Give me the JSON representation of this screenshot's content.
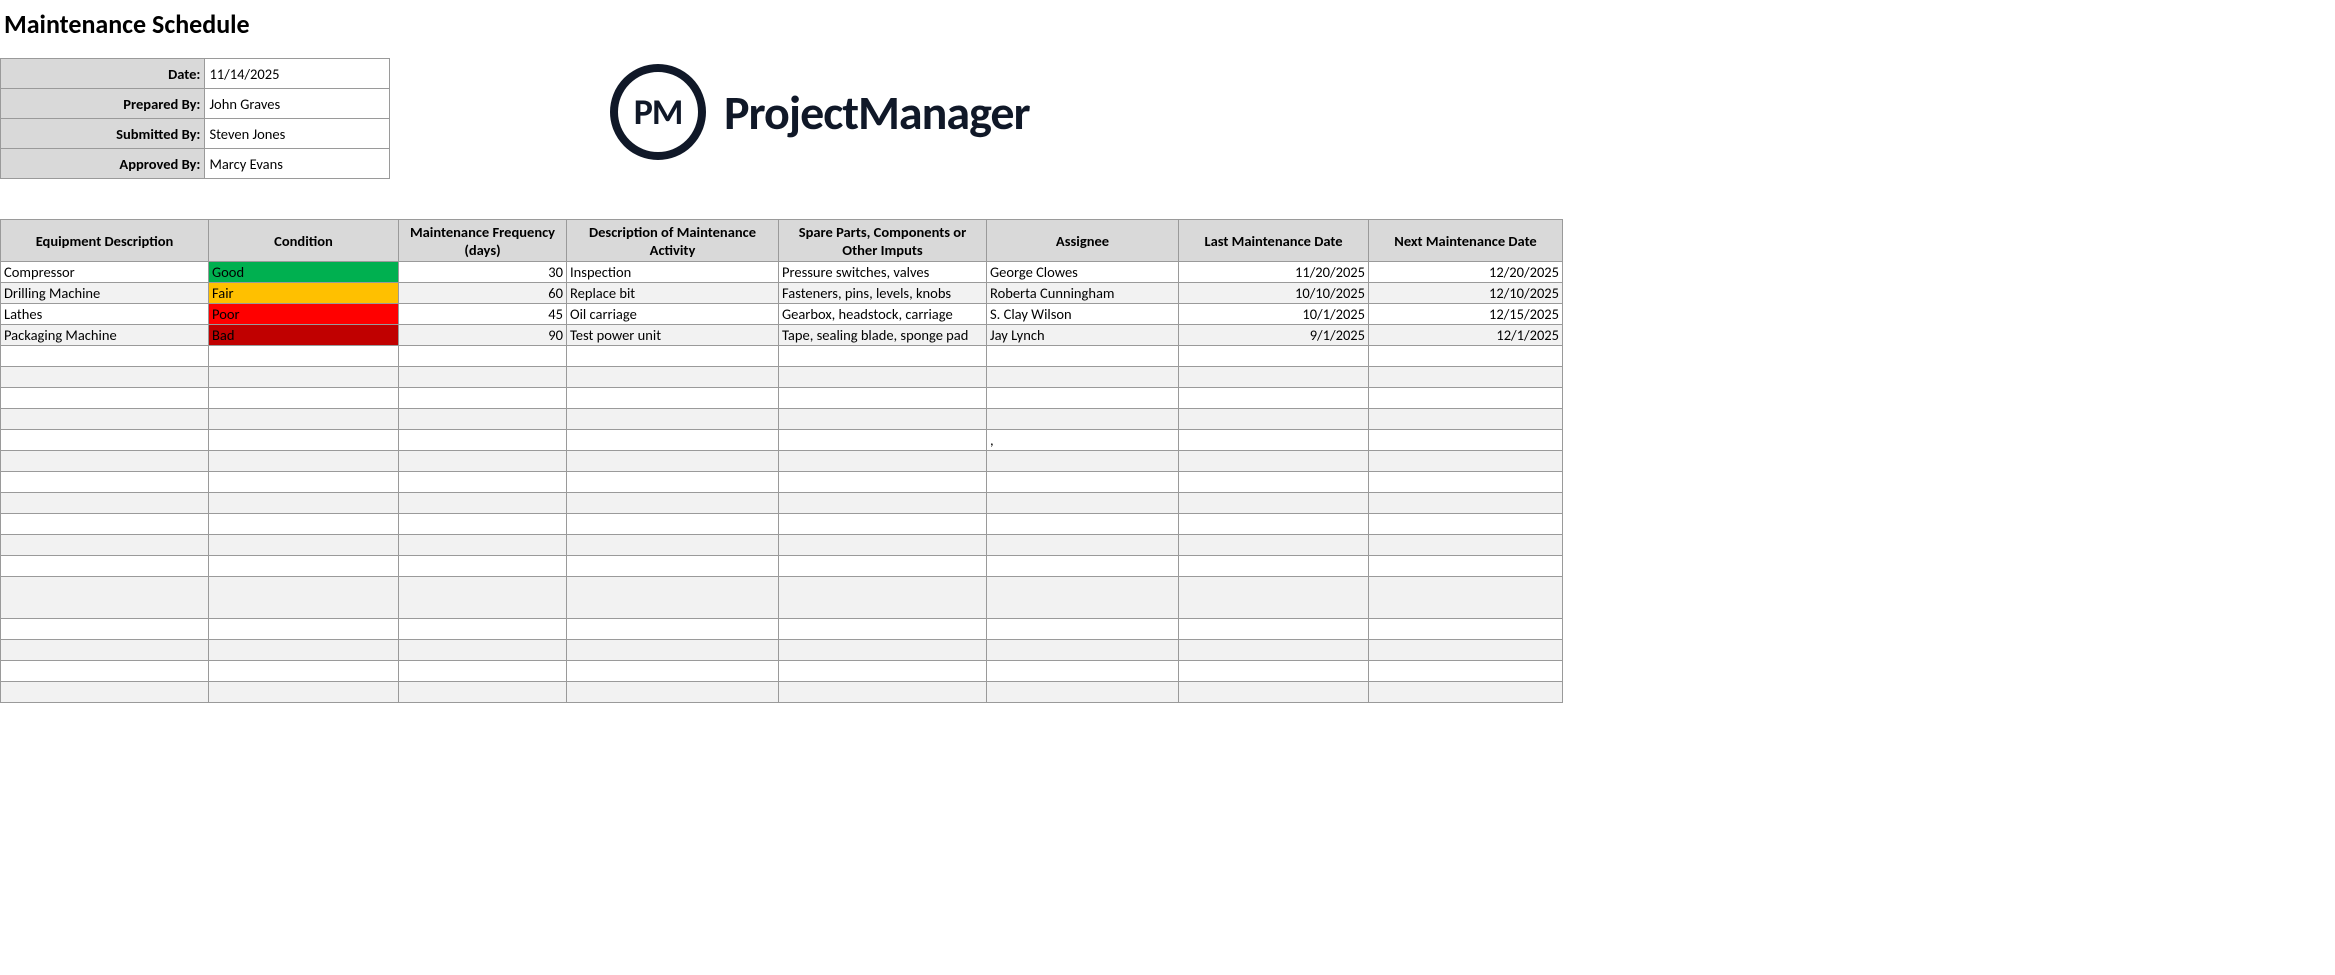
{
  "title": "Maintenance Schedule",
  "meta": {
    "labels": {
      "date": "Date:",
      "prepared": "Prepared By:",
      "submitted": "Submitted By:",
      "approved": "Approved By:"
    },
    "values": {
      "date": "11/14/2025",
      "prepared": "John Graves",
      "submitted": "Steven Jones",
      "approved": "Marcy Evans"
    }
  },
  "logo": {
    "abbrev": "PM",
    "text": "ProjectManager"
  },
  "headers": {
    "equipment": "Equipment Description",
    "condition": "Condition",
    "frequency": "Maintenance Frequency (days)",
    "activity": "Description of Maintenance Activity",
    "spare": "Spare Parts, Components or Other Imputs",
    "assignee": "Assignee",
    "last": "Last Maintenance Date",
    "next": "Next Maintenance Date"
  },
  "rows": [
    {
      "equipment": "Compressor",
      "condition": "Good",
      "condClass": "cond-good",
      "frequency": "30",
      "activity": "Inspection",
      "spare": "Pressure switches, valves",
      "assignee": "George Clowes",
      "last": "11/20/2025",
      "next": "12/20/2025"
    },
    {
      "equipment": "Drilling Machine",
      "condition": "Fair",
      "condClass": "cond-fair",
      "frequency": "60",
      "activity": "Replace bit",
      "spare": "Fasteners, pins, levels, knobs",
      "assignee": "Roberta Cunningham",
      "last": "10/10/2025",
      "next": "12/10/2025"
    },
    {
      "equipment": "Lathes",
      "condition": "Poor",
      "condClass": "cond-poor",
      "frequency": "45",
      "activity": "Oil carriage",
      "spare": "Gearbox, headstock, carriage",
      "assignee": "S. Clay Wilson",
      "last": "10/1/2025",
      "next": "12/15/2025"
    },
    {
      "equipment": "Packaging Machine",
      "condition": "Bad",
      "condClass": "cond-bad",
      "frequency": "90",
      "activity": "Test power unit",
      "spare": "Tape, sealing blade, sponge pad",
      "assignee": "Jay Lynch",
      "last": "9/1/2025",
      "next": "12/1/2025"
    }
  ],
  "stray": {
    "comma": ","
  },
  "emptyRowCount": 16,
  "strayRowIndex": 8,
  "tallRowIndex": 15
}
